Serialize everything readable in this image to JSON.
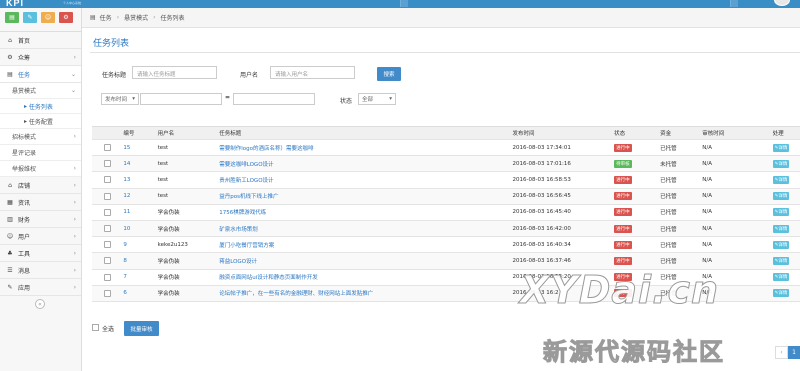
{
  "app": {
    "logo": "KPI",
    "logo_sub": "个人中心系统"
  },
  "shortcuts": [
    {
      "icon": "chart-icon",
      "color": "#5cb85c",
      "glyph": "▤"
    },
    {
      "icon": "pencil-icon",
      "color": "#5bc0de",
      "glyph": "✎"
    },
    {
      "icon": "users-icon",
      "color": "#f0ad4e",
      "glyph": "☺"
    },
    {
      "icon": "cog-icon",
      "color": "#d9534f",
      "glyph": "⚙"
    }
  ],
  "sidebar": {
    "home": "首页",
    "crowd": "众筹",
    "task": "任务",
    "reward_mode": "悬赏模式",
    "task_list": "任务列表",
    "task_config": "任务配置",
    "bid_mode": "招标模式",
    "rating": "星评记录",
    "report": "举报维权",
    "shop": "店铺",
    "info": "资讯",
    "finance": "财务",
    "user": "用户",
    "tools": "工具",
    "message": "消息",
    "app": "应用"
  },
  "breadcrumb": [
    "任务",
    "悬赏模式",
    "任务列表"
  ],
  "page_title": "任务列表",
  "search": {
    "title_label": "任务标题",
    "title_placeholder": "请输入任务标题",
    "user_label": "用户名",
    "user_placeholder": "请输入用户名",
    "submit": "搜索",
    "time_select": "发布时间",
    "range_sep": "=",
    "status_label": "状态",
    "status_select": "全部"
  },
  "table": {
    "headers": [
      "编号",
      "用户名",
      "任务标题",
      "发布时间",
      "状态",
      "资金",
      "审核时间",
      "处理"
    ],
    "rows": [
      {
        "id": "15",
        "user": "test",
        "title": "需要制作logo的酒店名称）需要这咖啡",
        "time": "2016-08-03 17:34:01",
        "status": "进行中",
        "status_kind": "red",
        "fund": "已托管",
        "audit": "N/A",
        "action": "详情"
      },
      {
        "id": "14",
        "user": "test",
        "title": "需要这咖啡LOGO设计",
        "time": "2016-08-03 17:01:16",
        "status": "待审核",
        "status_kind": "green",
        "fund": "未托管",
        "audit": "N/A",
        "action": "详情"
      },
      {
        "id": "13",
        "user": "test",
        "title": "贵州胜新工LOGO设计",
        "time": "2016-08-03 16:58:53",
        "status": "进行中",
        "status_kind": "red",
        "fund": "已托管",
        "audit": "N/A",
        "action": "详情"
      },
      {
        "id": "12",
        "user": "test",
        "title": "益丹pos机线下线上推广",
        "time": "2016-08-03 16:56:45",
        "status": "进行中",
        "status_kind": "red",
        "fund": "已托管",
        "audit": "N/A",
        "action": "详情"
      },
      {
        "id": "11",
        "user": "学会伪装",
        "title": "1756棋牌游戏代练",
        "time": "2016-08-03 16:45:40",
        "status": "进行中",
        "status_kind": "red",
        "fund": "已托管",
        "audit": "N/A",
        "action": "详情"
      },
      {
        "id": "10",
        "user": "学会伪装",
        "title": "矿泉水市场策划",
        "time": "2016-08-03 16:42:00",
        "status": "进行中",
        "status_kind": "red",
        "fund": "已托管",
        "audit": "N/A",
        "action": "详情"
      },
      {
        "id": "9",
        "user": "keke2u123",
        "title": "厦门小吃餐厅营销方案",
        "time": "2016-08-03 16:40:34",
        "status": "进行中",
        "status_kind": "red",
        "fund": "已托管",
        "audit": "N/A",
        "action": "详情"
      },
      {
        "id": "8",
        "user": "学会伪装",
        "title": "蒋益LOGO设计",
        "time": "2016-08-03 16:37:46",
        "status": "进行中",
        "status_kind": "red",
        "fund": "已托管",
        "audit": "N/A",
        "action": "详情"
      },
      {
        "id": "7",
        "user": "学会伪装",
        "title": "融资点面网站ui设计和静态页面制作开发",
        "time": "2016-08-03 16:33:20",
        "status": "进行中",
        "status_kind": "red",
        "fund": "已托管",
        "audit": "N/A",
        "action": "详情"
      },
      {
        "id": "6",
        "user": "学会伪装",
        "title": "论坛帖子推广，在一些有名的金融理财、财经网站上面发贴推广",
        "time": "2016-08-03 16:2",
        "status": "进行中",
        "status_kind": "red",
        "fund": "已托管",
        "audit": "N/A",
        "action": "详情"
      }
    ]
  },
  "footer": {
    "select_all": "全选",
    "batch_audit": "批量审核",
    "pages": [
      "‹",
      "1"
    ]
  },
  "watermark": {
    "line1": "XYDai.cn",
    "line2": "新源代源码社区"
  },
  "colors": {
    "topbar": "#3a8ec6",
    "link": "#2a77c2",
    "primary": "#428bca"
  }
}
